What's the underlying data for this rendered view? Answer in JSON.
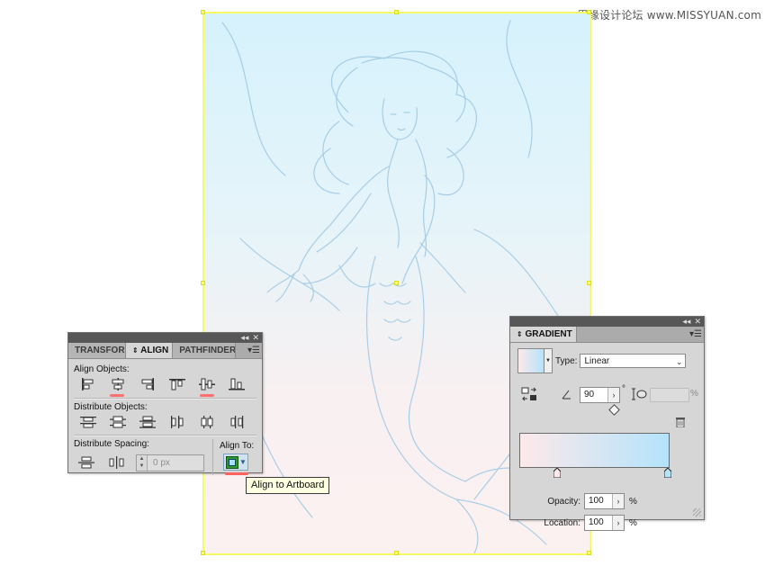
{
  "watermark": "思缘设计论坛 www.MISSYUAN.com",
  "align_panel": {
    "tabs": [
      "TRANSFORM",
      "ALIGN",
      "PATHFINDER"
    ],
    "align_objects_label": "Align Objects:",
    "distribute_objects_label": "Distribute Objects:",
    "distribute_spacing_label": "Distribute Spacing:",
    "align_to_label": "Align To:",
    "spacing_value": "0 px",
    "highlighted_buttons": [
      "horizontal-align-center",
      "vertical-align-center",
      "align-to-artboard"
    ]
  },
  "tooltip": {
    "text": "Align to Artboard"
  },
  "gradient_panel": {
    "title": "GRADIENT",
    "type_label": "Type:",
    "type_value": "Linear",
    "angle_value": "90",
    "angle_unit": "°",
    "aspect_unit": "%",
    "opacity_label": "Opacity:",
    "opacity_value": "100",
    "opacity_unit": "%",
    "location_label": "Location:",
    "location_value": "100",
    "location_unit": "%",
    "stop_colors": [
      "#fde9ea",
      "#b4e3fb"
    ]
  },
  "colors": {
    "artboard_top": "#d6f2fd",
    "artboard_bottom": "#fcf1f1",
    "artboard_border": "#fbff60",
    "panel_bg": "#d6d6d6",
    "highlight_underline": "#ff6060",
    "sketch_stroke": "#9cc7e4"
  }
}
